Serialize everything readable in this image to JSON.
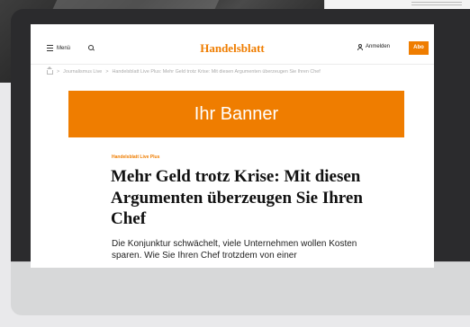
{
  "site": {
    "menu_label": "Menü",
    "logo": "Handelsblatt",
    "login_label": "Anmelden",
    "abo_label": "Abo"
  },
  "breadcrumb": {
    "items": [
      "Journalismus Live",
      "Handelsblatt Live Plus: Mehr Geld trotz Krise: Mit diesen Argumenten überzeugen Sie Ihren Chef"
    ],
    "separator": ">"
  },
  "banner": {
    "label": "Ihr Banner",
    "color": "#ef7d00"
  },
  "article": {
    "kicker": "Handelsblatt Live Plus",
    "headline": "Mehr Geld trotz Krise: Mit diesen Argumenten überzeugen Sie Ihren Chef",
    "teaser": "Die Konjunktur schwächelt, viele Unternehmen wollen Kosten sparen. Wie Sie Ihren Chef trotzdem von einer"
  },
  "icons": [
    "menu-icon",
    "search-icon",
    "user-icon",
    "home-icon",
    "camera-icon"
  ],
  "colors": {
    "accent": "#ef7d00",
    "bezel": "#2b2b2d",
    "base": "#d7d8d9"
  }
}
